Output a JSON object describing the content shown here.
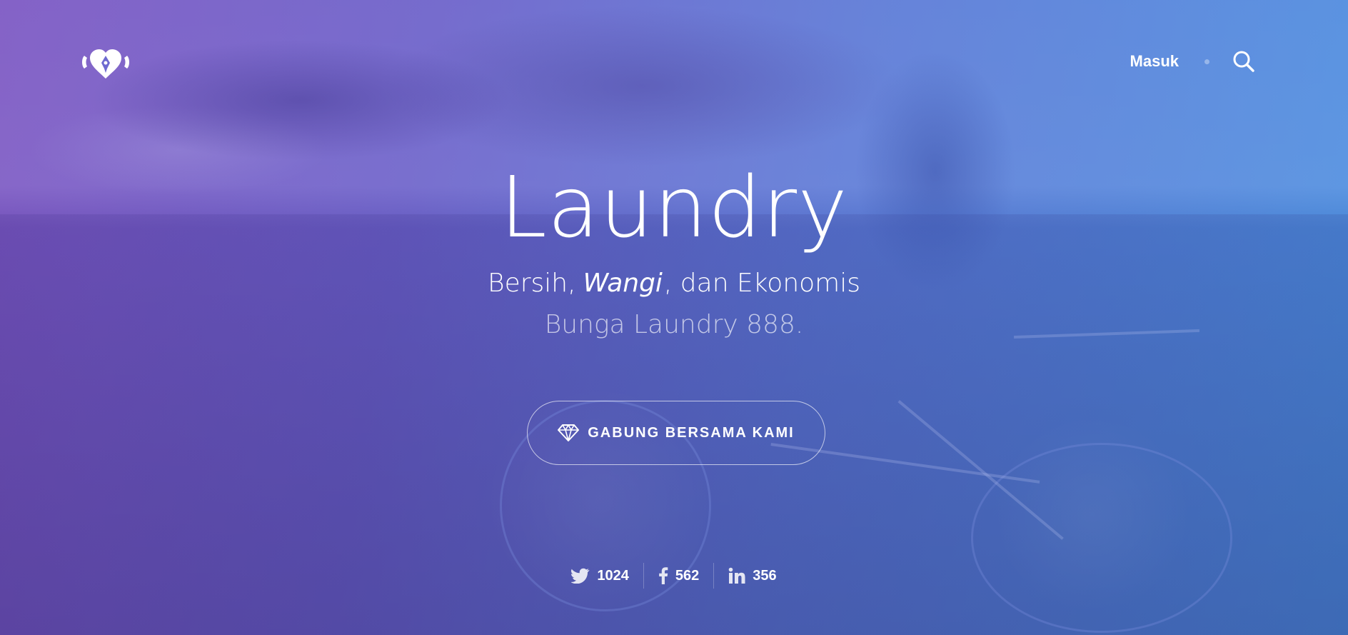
{
  "brand": {
    "logo_icon": "heart-pen-logo-icon"
  },
  "nav": {
    "login_label": "Masuk",
    "search_icon": "search-icon"
  },
  "hero": {
    "title": "Laundry",
    "tagline_before": "Bersih,",
    "tagline_emphasis": "Wangi",
    "tagline_after": ", dan Ekonomis",
    "subtitle": "Bunga Laundry 888.",
    "cta_label": "GABUNG BERSAMA KAMI",
    "cta_icon": "diamond-icon"
  },
  "social": [
    {
      "icon": "twitter-icon",
      "count": "1024"
    },
    {
      "icon": "facebook-icon",
      "count": "562"
    },
    {
      "icon": "linkedin-icon",
      "count": "356"
    }
  ],
  "colors": {
    "gradient_left": "#7a55c2",
    "gradient_right": "#4a8ee0",
    "text": "#ffffff"
  }
}
